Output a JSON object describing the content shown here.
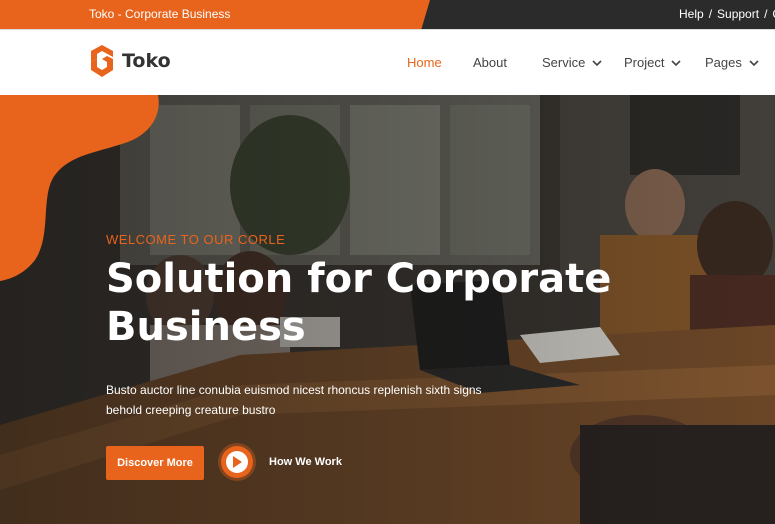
{
  "topbar": {
    "title": "Toko - Corporate Business",
    "links": [
      "Help",
      "Support",
      "C"
    ],
    "separator": "/"
  },
  "brand": {
    "name": "Toko",
    "logo_icon": "toko-logo-icon",
    "accent": "#e8641c"
  },
  "nav": {
    "items": [
      {
        "label": "Home",
        "active": true,
        "dropdown": false
      },
      {
        "label": "About",
        "active": false,
        "dropdown": false
      },
      {
        "label": "Service",
        "active": false,
        "dropdown": true
      },
      {
        "label": "Project",
        "active": false,
        "dropdown": true
      },
      {
        "label": "Pages",
        "active": false,
        "dropdown": true
      }
    ]
  },
  "hero": {
    "kicker": "WELCOME TO OUR CORLE",
    "title_line1": "Solution for Corporate",
    "title_line2": "Business",
    "desc_line1": "Busto auctor line conubia euismod nicest rhoncus replenish sixth signs",
    "desc_line2": "behold creeping creature bustro",
    "primary_button": "Discover More",
    "video_button_icon": "play-icon",
    "secondary_link": "How We Work"
  }
}
